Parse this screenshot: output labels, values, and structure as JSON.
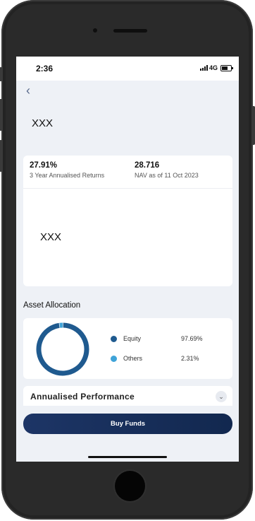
{
  "status_bar": {
    "time": "2:36",
    "network": "4G"
  },
  "header": {
    "back_icon": "chevron-left-icon",
    "fund_name": "XXX"
  },
  "summary": {
    "returns_value": "27.91%",
    "returns_label": "3 Year Annualised Returns",
    "nav_value": "28.716",
    "nav_label": "NAV as of 11 Oct 2023",
    "placeholder_text": "XXX"
  },
  "asset_allocation": {
    "title": "Asset Allocation",
    "items": [
      {
        "label": "Equity",
        "percent": "97.69%",
        "value": 97.69,
        "color": "#1f5a8f"
      },
      {
        "label": "Others",
        "percent": "2.31%",
        "value": 2.31,
        "color": "#3fa3d8"
      }
    ]
  },
  "performance": {
    "title": "Annualised Performance",
    "chevron_icon": "chevron-down-icon"
  },
  "actions": {
    "buy_label": "Buy Funds"
  }
}
